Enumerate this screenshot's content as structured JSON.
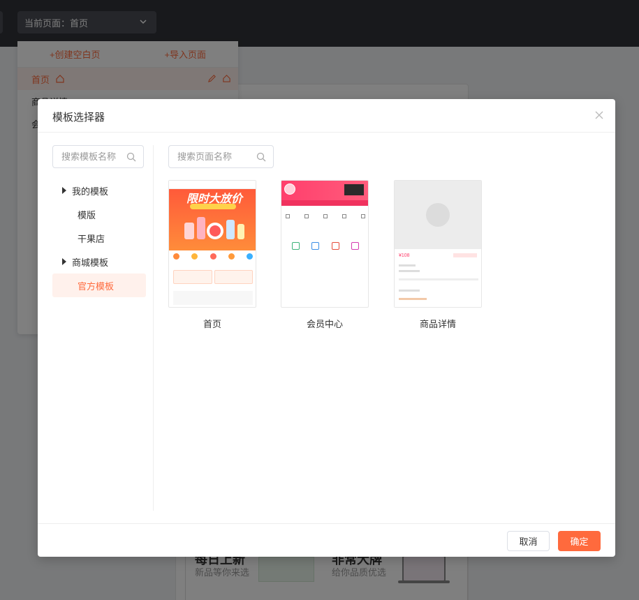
{
  "header": {
    "page_select_label": "当前页面：首页"
  },
  "pages_panel": {
    "create_blank": "+创建空白页",
    "import_page": "+导入页面",
    "rows": [
      {
        "label": "首页"
      },
      {
        "label": "商品详情"
      },
      {
        "label": "会员中心"
      }
    ]
  },
  "background_preview": {
    "promo_left_title": "每日上新",
    "promo_left_sub": "新品等你来选",
    "promo_right_title": "非常大牌",
    "promo_right_sub": "给你品质优选"
  },
  "modal": {
    "title": "模板选择器",
    "template_search_placeholder": "搜索模板名称",
    "page_search_placeholder": "搜索页面名称",
    "tree": [
      {
        "label": "我的模板",
        "expandable": true
      },
      {
        "label": "模版",
        "expandable": false
      },
      {
        "label": "干果店",
        "expandable": false
      },
      {
        "label": "商城模板",
        "expandable": true
      },
      {
        "label": "官方模板",
        "expandable": false,
        "active": true
      }
    ],
    "templates": [
      {
        "label": "首页",
        "banner_text": "限时大放价",
        "icon": "homepage-thumbnail"
      },
      {
        "label": "会员中心",
        "icon": "member-center-thumbnail"
      },
      {
        "label": "商品详情",
        "price_text": "¥108",
        "icon": "product-detail-thumbnail"
      }
    ],
    "cancel_label": "取消",
    "ok_label": "确定"
  },
  "colors": {
    "accent": "#ff6a3d",
    "topbar": "#313338"
  }
}
